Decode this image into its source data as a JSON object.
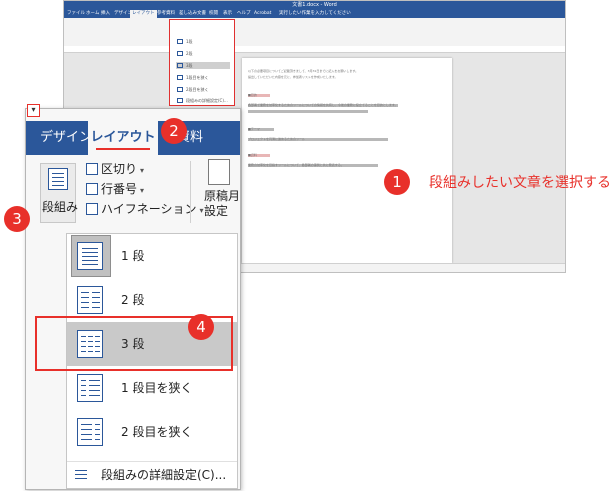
{
  "background_window": {
    "title": "文書1.docx - Word",
    "tabs": [
      "ファイル",
      "ホーム",
      "挿入",
      "デザイン",
      "レイアウト",
      "参考資料",
      "差し込み文書",
      "校閲",
      "表示",
      "ヘルプ",
      "Acrobat",
      "実行したい作業を入力してください"
    ],
    "active_tab": "レイアウト",
    "dropdown_items": [
      "1段",
      "2段",
      "3段",
      "1段目を狭く",
      "2段目を狭く",
      "段組みの詳細設定(C)..."
    ],
    "doc_lines": [
      "以下の必要項目についてご記載頂きまして、3月31日までに記入をお願いします。",
      "提出していただいた内容を元に、参加者リストを作成いたします。",
      "■目的",
      "各部署で業務を効率化するためのツールについての情報を共有し、今後の業務に役立てることを目的とします。",
      "■テーマ",
      "プロジェクトを円滑に進めるためのツール",
      "■資料",
      "業務の効率化を目指すツールについて、各部署の事例と共に発表する。"
    ]
  },
  "callouts": {
    "c1": "1",
    "c2": "2",
    "c3": "3",
    "c4": "4",
    "instruction": "段組みしたい文章を選択する"
  },
  "panel": {
    "tabs": {
      "design": "デザイン",
      "layout": "レイアウト",
      "references": "考資料"
    },
    "columns_button": "段組み",
    "breaks": "区切り",
    "line_numbers": "行番号",
    "hyphenation": "ハイフネーション",
    "right_button": "原稿月\n設定",
    "menu": {
      "items": [
        {
          "label": "1 段"
        },
        {
          "label": "2 段"
        },
        {
          "label": "3 段"
        },
        {
          "label": "1 段目を狭く"
        },
        {
          "label": "2 段目を狭く"
        }
      ],
      "footer": "段組みの詳細設定(C)..."
    }
  },
  "colors": {
    "accent": "#2b579a",
    "callout": "#e8302a",
    "selection": "#c9c9c9"
  }
}
